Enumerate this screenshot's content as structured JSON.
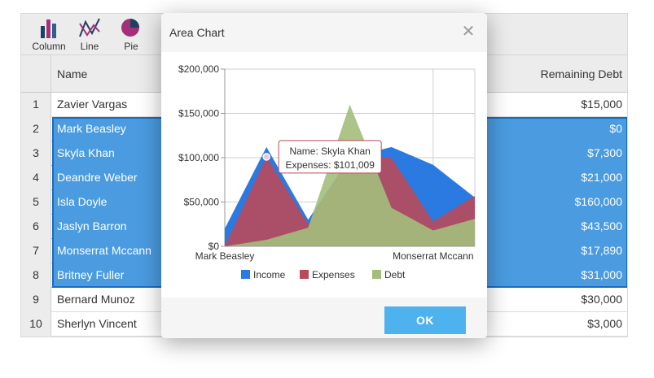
{
  "toolbar": {
    "buttons": [
      {
        "label": "Column",
        "icon": "column-chart-icon"
      },
      {
        "label": "Line",
        "icon": "line-chart-icon"
      },
      {
        "label": "Pie",
        "icon": "pie-chart-icon"
      }
    ]
  },
  "grid": {
    "columns": {
      "name": "Name",
      "debt": "Remaining Debt"
    },
    "rows": [
      {
        "num": "1",
        "name": "Zavier Vargas",
        "debt": "$15,000",
        "selected": false
      },
      {
        "num": "2",
        "name": "Mark Beasley",
        "debt": "$0",
        "selected": true
      },
      {
        "num": "3",
        "name": "Skyla Khan",
        "debt": "$7,300",
        "selected": true
      },
      {
        "num": "4",
        "name": "Deandre Weber",
        "debt": "$21,000",
        "selected": true
      },
      {
        "num": "5",
        "name": "Isla Doyle",
        "debt": "$160,000",
        "selected": true
      },
      {
        "num": "6",
        "name": "Jaslyn Barron",
        "debt": "$43,500",
        "selected": true
      },
      {
        "num": "7",
        "name": "Monserrat Mccann",
        "debt": "$17,890",
        "selected": true
      },
      {
        "num": "8",
        "name": "Britney Fuller",
        "debt": "$31,000",
        "selected": true
      },
      {
        "num": "9",
        "name": "Bernard Munoz",
        "debt": "$30,000",
        "selected": false
      },
      {
        "num": "10",
        "name": "Sherlyn Vincent",
        "debt": "$3,000",
        "selected": false
      }
    ],
    "colors": {
      "selected": "#4a9be0",
      "header": "#ececec"
    }
  },
  "dialog": {
    "title": "Area Chart",
    "close_glyph": "✕",
    "ok_label": "OK"
  },
  "chart_data": {
    "type": "area",
    "categories": [
      "Mark Beasley",
      "Skyla Khan",
      "Deandre Weber",
      "Isla Doyle",
      "Jaslyn Barron",
      "Monserrat Mccann",
      "Britney Fuller"
    ],
    "tick_labels_x": [
      "Mark Beasley",
      "Monserrat Mccann"
    ],
    "ylim": [
      0,
      200000
    ],
    "y_ticks": [
      "$0",
      "$50,000",
      "$100,000",
      "$150,000",
      "$200,000"
    ],
    "y_tick_values": [
      0,
      50000,
      100000,
      150000,
      200000
    ],
    "series": [
      {
        "name": "Income",
        "color": "#2a7ae2",
        "values": [
          20000,
          112000,
          30000,
          100000,
          112000,
          92000,
          55000
        ]
      },
      {
        "name": "Expenses",
        "color": "#b84a5a",
        "values": [
          0,
          101009,
          25000,
          100000,
          100000,
          28000,
          57000
        ]
      },
      {
        "name": "Debt",
        "color": "#a3be7b",
        "values": [
          0,
          7300,
          21000,
          160000,
          43500,
          17890,
          31000
        ]
      }
    ],
    "tooltip": {
      "line1": "Name: Skyla Khan",
      "line2": "Expenses: $101,009"
    },
    "grid": true,
    "legend_position": "bottom"
  }
}
